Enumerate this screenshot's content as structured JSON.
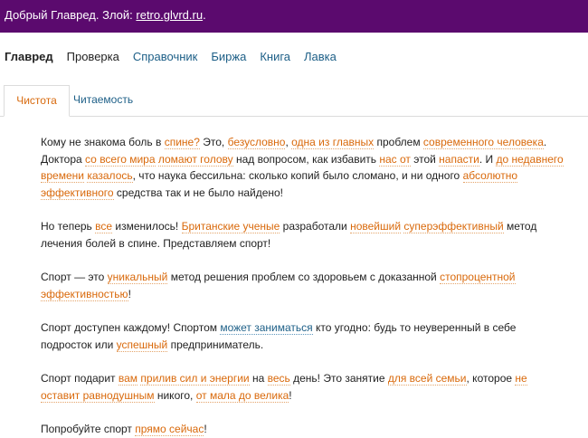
{
  "header": {
    "greeting": "Добрый Главред. Злой: ",
    "link": "retro.glvrd.ru",
    "dot": "."
  },
  "nav": {
    "items": [
      {
        "label": "Главред"
      },
      {
        "label": "Проверка"
      },
      {
        "label": "Справочник"
      },
      {
        "label": "Биржа"
      },
      {
        "label": "Книга"
      },
      {
        "label": "Лавка"
      }
    ]
  },
  "tabs": {
    "active": "Чистота",
    "inactive": "Читаемость"
  },
  "paragraphs": [
    [
      {
        "t": "Кому не знакома боль в "
      },
      {
        "t": "спине?",
        "h": "o"
      },
      {
        "t": " Это, "
      },
      {
        "t": "безусловно",
        "h": "o"
      },
      {
        "t": ", "
      },
      {
        "t": "одна из главных",
        "h": "o"
      },
      {
        "t": " проблем "
      },
      {
        "t": "современного человека",
        "h": "o"
      },
      {
        "t": ". Доктора "
      },
      {
        "t": "со всего мира",
        "h": "o"
      },
      {
        "t": " "
      },
      {
        "t": "ломают голову",
        "h": "o"
      },
      {
        "t": " над вопросом, как избавить "
      },
      {
        "t": "нас от",
        "h": "o"
      },
      {
        "t": " этой "
      },
      {
        "t": "напасти",
        "h": "o"
      },
      {
        "t": ". И "
      },
      {
        "t": "до недавнего времени",
        "h": "o"
      },
      {
        "t": " "
      },
      {
        "t": "казалось",
        "h": "o"
      },
      {
        "t": ", что наука бессильна: сколько копий было сломано, и ни одного "
      },
      {
        "t": "абсолютно эффективного",
        "h": "o"
      },
      {
        "t": " средства так и не было найдено!"
      }
    ],
    [
      {
        "t": "Но теперь "
      },
      {
        "t": "все",
        "h": "o"
      },
      {
        "t": " изменилось! "
      },
      {
        "t": "Британские ученые",
        "h": "o"
      },
      {
        "t": " разработали "
      },
      {
        "t": "новейший",
        "h": "o"
      },
      {
        "t": " "
      },
      {
        "t": "суперэффективный",
        "h": "o"
      },
      {
        "t": " метод лечения болей в спине. Представляем спорт!"
      }
    ],
    [
      {
        "t": "Спорт — это "
      },
      {
        "t": "уникальный",
        "h": "o"
      },
      {
        "t": " метод решения проблем со здоровьем с доказанной "
      },
      {
        "t": "стопроцентной эффективностью",
        "h": "o"
      },
      {
        "t": "!"
      }
    ],
    [
      {
        "t": "Спорт доступен каждому! Спортом "
      },
      {
        "t": "может заниматься",
        "h": "b"
      },
      {
        "t": " кто угодно: будь то неуверенный в себе подросток или "
      },
      {
        "t": "успешный",
        "h": "o"
      },
      {
        "t": " предприниматель."
      }
    ],
    [
      {
        "t": "Спорт подарит "
      },
      {
        "t": "вам",
        "h": "o"
      },
      {
        "t": " "
      },
      {
        "t": "прилив сил и энергии",
        "h": "o"
      },
      {
        "t": " на "
      },
      {
        "t": "весь",
        "h": "o"
      },
      {
        "t": " день! Это занятие "
      },
      {
        "t": "для всей семьи",
        "h": "o"
      },
      {
        "t": ", которое "
      },
      {
        "t": "не оставит равнодушным",
        "h": "o"
      },
      {
        "t": " никого, "
      },
      {
        "t": "от мала до велика",
        "h": "o"
      },
      {
        "t": "!"
      }
    ],
    [
      {
        "t": "Попробуйте спорт "
      },
      {
        "t": "прямо сейчас",
        "h": "o"
      },
      {
        "t": "!"
      }
    ]
  ],
  "colors": {
    "header_bg": "#5b0a6e",
    "highlight_orange": "#d9690b",
    "highlight_blue": "#1d5f87"
  }
}
